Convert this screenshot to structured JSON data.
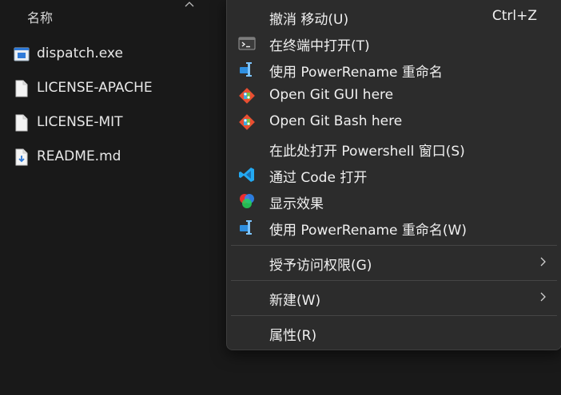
{
  "explorer": {
    "column_header": "名称",
    "files": [
      {
        "name": "dispatch.exe",
        "icon": "exe-file-icon"
      },
      {
        "name": "LICENSE-APACHE",
        "icon": "file-icon"
      },
      {
        "name": "LICENSE-MIT",
        "icon": "file-icon"
      },
      {
        "name": "README.md",
        "icon": "markdown-file-icon"
      }
    ]
  },
  "menu": {
    "items": [
      {
        "label": "撤消 移动(U)",
        "shortcut": "Ctrl+Z",
        "icon": ""
      },
      {
        "label": "在终端中打开(T)",
        "icon": "terminal-icon"
      },
      {
        "label": "使用 PowerRename 重命名",
        "icon": "powerrename-icon"
      },
      {
        "label": "Open Git GUI here",
        "icon": "git-icon"
      },
      {
        "label": "Open Git Bash here",
        "icon": "git-icon"
      },
      {
        "label": "在此处打开 Powershell 窗口(S)",
        "icon": ""
      },
      {
        "label": "通过 Code 打开",
        "icon": "vscode-icon"
      },
      {
        "label": "显示效果",
        "icon": "color-circles-icon"
      },
      {
        "label": "使用 PowerRename 重命名(W)",
        "icon": "powerrename-icon"
      },
      {
        "label": "授予访问权限(G)",
        "submenu": true
      },
      {
        "label": "新建(W)",
        "submenu": true
      },
      {
        "label": "属性(R)"
      }
    ]
  },
  "colors": {
    "background": "#191919",
    "menu_background": "#2c2c2c",
    "vscode_blue": "#23a9f2",
    "git_red": "#e94e31",
    "powerrename_blue": "#2f8fe0"
  }
}
